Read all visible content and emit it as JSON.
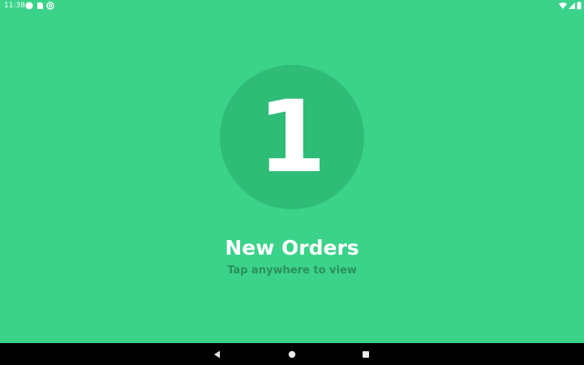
{
  "status_bar": {
    "time": "11:38",
    "icons": [
      "circle-notification-icon",
      "sd-card-icon",
      "at-sign-icon",
      "wifi-icon",
      "signal-icon",
      "battery-icon"
    ]
  },
  "orders": {
    "count": "1",
    "title": "New Orders",
    "subtitle": "Tap anywhere to view"
  },
  "nav_bar": {
    "buttons": [
      "back-icon",
      "home-icon",
      "recents-icon"
    ]
  },
  "colors": {
    "background": "#3ad389",
    "circle": "#2fbc77",
    "subtitle": "#2a8f5e",
    "nav_bar": "#000000"
  }
}
